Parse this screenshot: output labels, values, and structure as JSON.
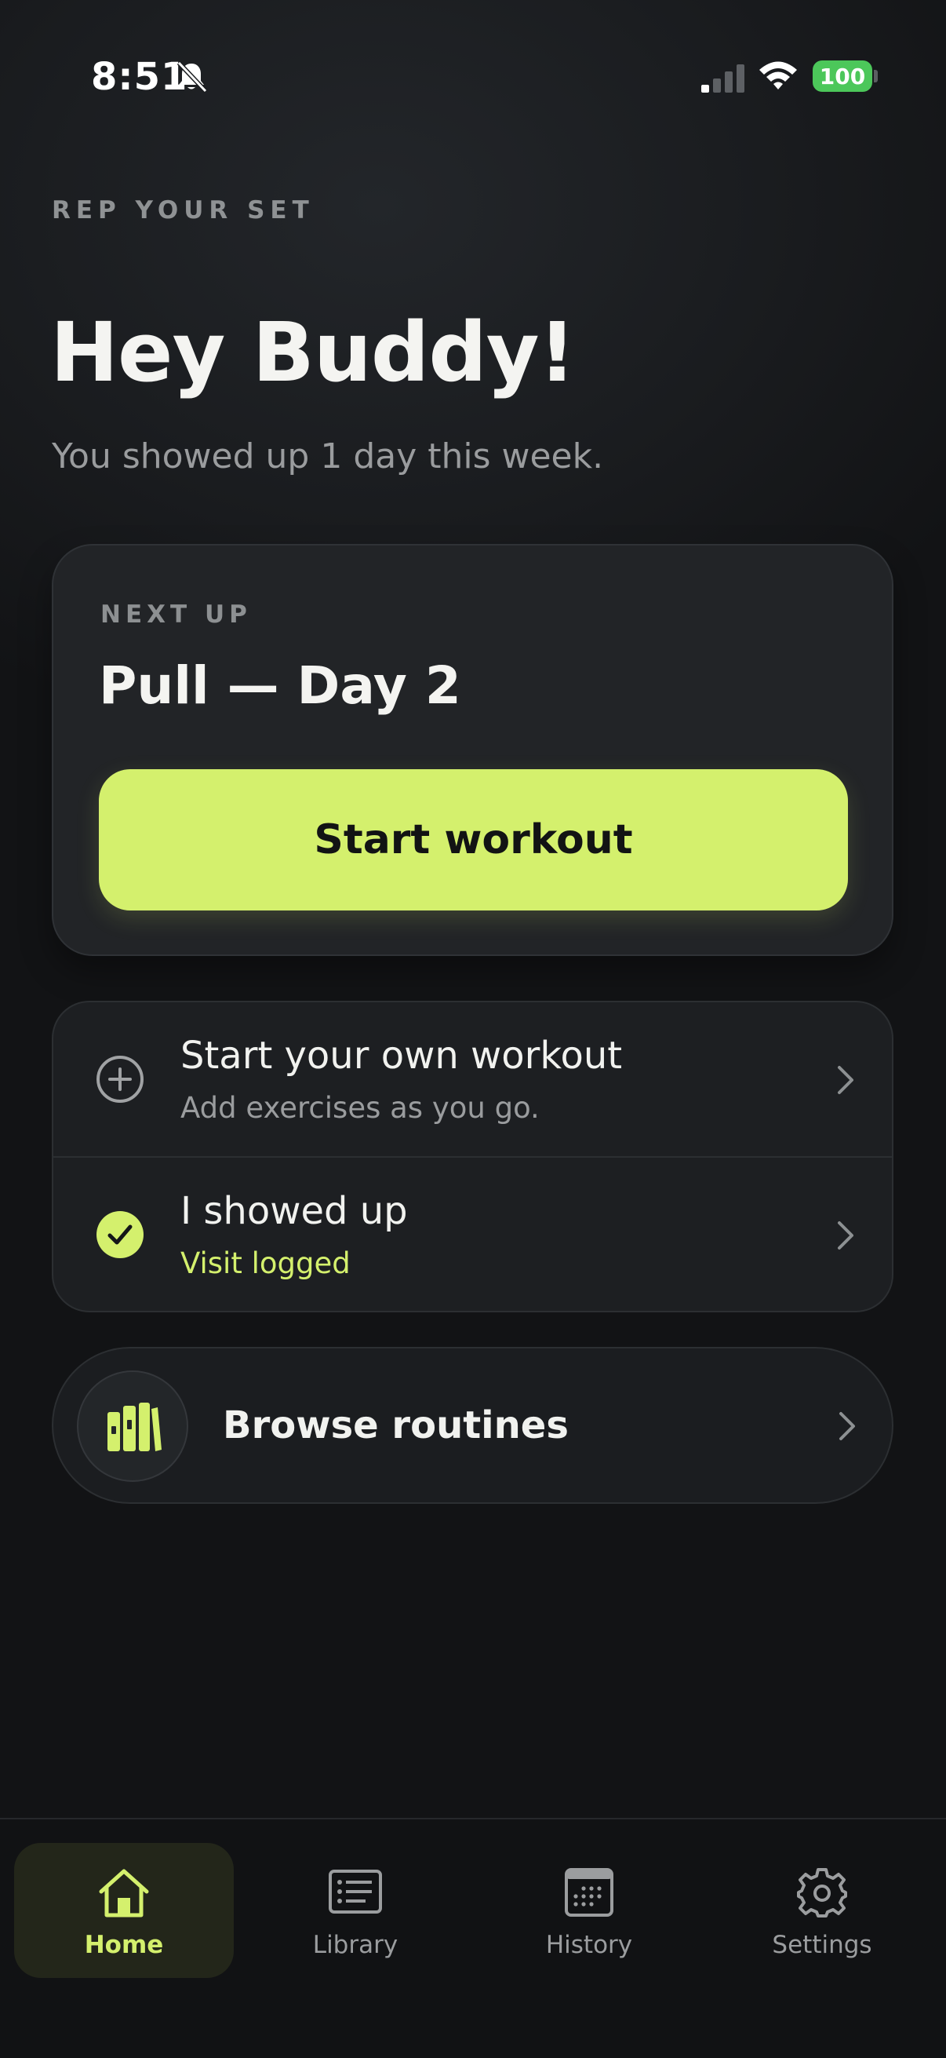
{
  "status_bar": {
    "time": "8:51",
    "battery": "100",
    "icons": [
      "bell-slash-icon",
      "signal-icon",
      "wifi-icon",
      "battery-icon"
    ]
  },
  "header": {
    "eyebrow": "REP YOUR SET",
    "title": "Hey Buddy!",
    "subtitle": "You showed up 1 day this week."
  },
  "next_up": {
    "label": "NEXT UP",
    "title": "Pull — Day 2",
    "button_label": "Start workout"
  },
  "actions": [
    {
      "title": "Start your own workout",
      "subtitle": "Add exercises as you go.",
      "icon": "plus-circle-icon"
    },
    {
      "title": "I showed up",
      "subtitle": "Visit logged",
      "icon": "check-circle-icon"
    }
  ],
  "browse": {
    "label": "Browse routines",
    "icon": "books-icon"
  },
  "tabs": [
    {
      "label": "Home",
      "icon": "home-icon",
      "active": true
    },
    {
      "label": "Library",
      "icon": "list-icon",
      "active": false
    },
    {
      "label": "History",
      "icon": "calendar-icon",
      "active": false
    },
    {
      "label": "Settings",
      "icon": "gear-icon",
      "active": false
    }
  ],
  "colors": {
    "accent": "#d4f06d",
    "background": "#141618",
    "card": "#222427",
    "battery": "#4cc75a"
  }
}
